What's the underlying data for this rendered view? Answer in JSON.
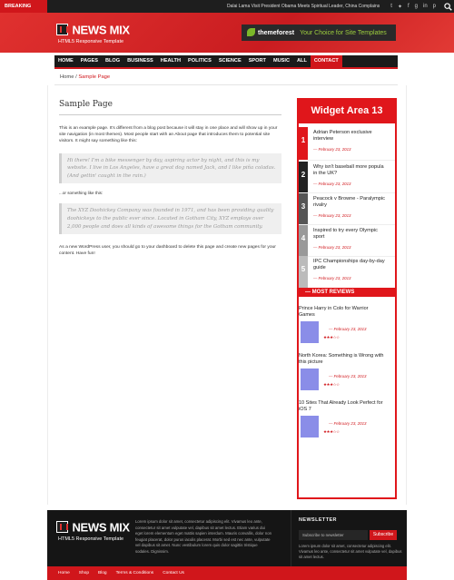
{
  "topbar": {
    "breaking_label": "BREAKING NEWS",
    "ticker": "Dalai Lama Visit President Obama Meets Spiritual Leader, China Complains",
    "social_icons": [
      "tumblr-icon",
      "twitter-icon",
      "facebook-icon",
      "google-plus-icon",
      "linkedin-icon",
      "pinterest-icon",
      "search-icon"
    ]
  },
  "header": {
    "logo_title": "NEWS MIX",
    "logo_sub": "HTML5 Responsive Template",
    "ad_brand": "themeforest",
    "ad_text": "Your Choice for Site Templates"
  },
  "nav": {
    "items": [
      "HOME",
      "PAGES",
      "BLOG",
      "BUSINESS",
      "HEALTH",
      "POLITICS",
      "SCIENCE",
      "SPORT",
      "MUSIC",
      "ALL",
      "CONTACT"
    ],
    "active": "CONTACT"
  },
  "breadcrumb": {
    "home": "Home",
    "sep": " / ",
    "current": "Sample Page"
  },
  "page": {
    "title": "Sample Page",
    "intro": "This is an example page. It's different from a blog post because it will stay in one place and will show up in your site navigation (in most themes). Most people start with an About page that introduces them to potential site visitors. It might say something like this:",
    "quote1": "Hi there! I'm a bike messenger by day, aspiring actor by night, and this is my website. I live in Los Angeles, have a great dog named Jack, and I like piña coladas. (And gettin' caught in the rain.)",
    "or_text": "...or something like this:",
    "quote2": "The XYZ Doohickey Company was founded in 1971, and has been providing quality doohickeys to the public ever since. Located in Gotham City, XYZ employs over 2,000 people and does all kinds of awesome things for the Gotham community.",
    "outro": "As a new WordPress user, you should go to your dashboard to delete this page and create new pages for your content. Have fun!"
  },
  "widget": {
    "title": "Widget Area 13",
    "items": [
      {
        "num": "1",
        "title": "Adrian Peterson exclusive",
        "title2": "interview",
        "date": "— February 23, 2013",
        "color": "#e0161b"
      },
      {
        "num": "2",
        "title": "Why isn't baseball more popula",
        "title2": "in the UK?",
        "date": "— February 23, 2013",
        "color": "#222222"
      },
      {
        "num": "3",
        "title": "Peacock v Browne - Paralympic",
        "title2": "rivalry",
        "date": "— February 23, 2013",
        "color": "#555555"
      },
      {
        "num": "4",
        "title": "Inspired to try every Olympic",
        "title2": "sport",
        "date": "— February 23, 2013",
        "color": "#999999"
      },
      {
        "num": "5",
        "title": "IPC Championships day-by-day",
        "title2": "guide",
        "date": "— February 23, 2013",
        "color": "#bbbbbb"
      }
    ]
  },
  "reviews": {
    "title": "— MOST REVIEWS",
    "items": [
      {
        "title": "Prince Harry in Colo for Warrior",
        "title2": "Games",
        "date": "— February 23, 2013",
        "stars": "★★★☆☆"
      },
      {
        "title": "North Korea: Something is Wrong with",
        "title2": "this picture",
        "date": "— February 23, 2013",
        "stars": "★★★☆☆"
      },
      {
        "title": "10 Sites That Already Look Perfect for",
        "title2": "iOS 7",
        "date": "— February 23, 2013",
        "stars": "★★★☆☆"
      }
    ]
  },
  "footer": {
    "logo_title": "NEWS MIX",
    "logo_sub": "HTML5 Responsive Template",
    "text": "Lorem ipsum dolor sit amet, consectetur adipiscing elit. Vivamus leo ante, consectetur sit amet vulputate vel, dapibus sit amet lectus. Etiam varius dui eget lorem elementum eget mattis sapien interdum. Mauris convallis, dolor non feugiat placerat, dolor purus iaculis placerat. Morbi sed est nec ante, vulputate vel dapibus sit amet. Nunc vestibulum lorem quis dolor sagittis tristique sodales. Dignissim.",
    "newsletter_title": "NEWSLETTER",
    "newsletter_placeholder": "Subscribe to newsletter",
    "subscribe_label": "Subscribe",
    "newsletter_text": "Lorem ipsum dolor sit amet, consectetur adipiscing elit. Vivamus leo ante, consectetur sit amet vulputate vel, dapibus sit amet lectus."
  },
  "bottom_nav": [
    "Home",
    "Shop",
    "Blog",
    "Terms & Conditions",
    "Contact Us"
  ]
}
